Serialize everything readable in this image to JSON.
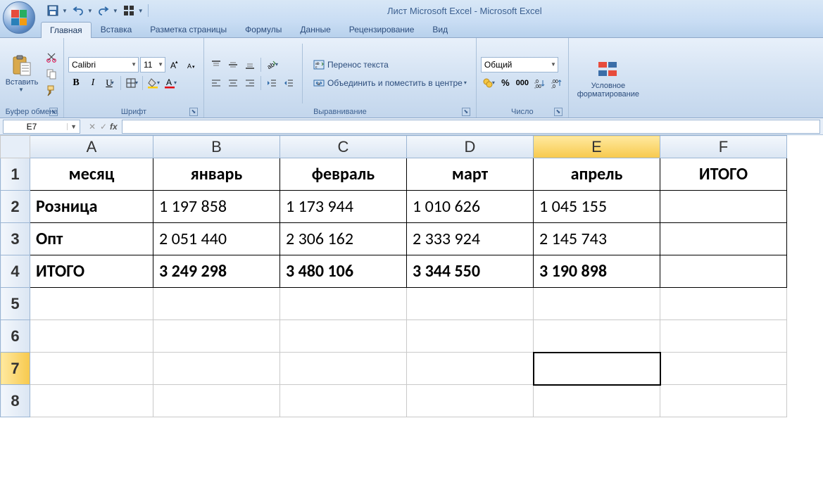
{
  "title": "Лист Microsoft Excel - Microsoft Excel",
  "tabs": [
    "Главная",
    "Вставка",
    "Разметка страницы",
    "Формулы",
    "Данные",
    "Рецензирование",
    "Вид"
  ],
  "active_tab": 0,
  "ribbon": {
    "clipboard": {
      "label": "Буфер обмена",
      "paste": "Вставить"
    },
    "font": {
      "label": "Шрифт",
      "name": "Calibri",
      "size": "11"
    },
    "alignment": {
      "label": "Выравнивание",
      "wrap": "Перенос текста",
      "merge": "Объединить и поместить в центре"
    },
    "number": {
      "label": "Число",
      "format": "Общий"
    },
    "condfmt": {
      "label": "Условное форматирование"
    }
  },
  "namebox": "E7",
  "formula": "",
  "columns": [
    "A",
    "B",
    "C",
    "D",
    "E",
    "F"
  ],
  "rows": [
    "1",
    "2",
    "3",
    "4",
    "5",
    "6",
    "7",
    "8"
  ],
  "data": {
    "r1": {
      "A": "месяц",
      "B": "январь",
      "C": "февраль",
      "D": "март",
      "E": "апрель",
      "F": "ИТОГО"
    },
    "r2": {
      "A": "Розница",
      "B": "1 197 858",
      "C": "1 173 944",
      "D": "1 010 626",
      "E": "1 045 155",
      "F": ""
    },
    "r3": {
      "A": "Опт",
      "B": "2 051 440",
      "C": "2 306 162",
      "D": "2 333 924",
      "E": "2 145 743",
      "F": ""
    },
    "r4": {
      "A": "ИТОГО",
      "B": "3 249 298",
      "C": "3 480 106",
      "D": "3 344 550",
      "E": "3 190 898",
      "F": ""
    }
  },
  "selection": {
    "col": "E",
    "row": "7"
  }
}
